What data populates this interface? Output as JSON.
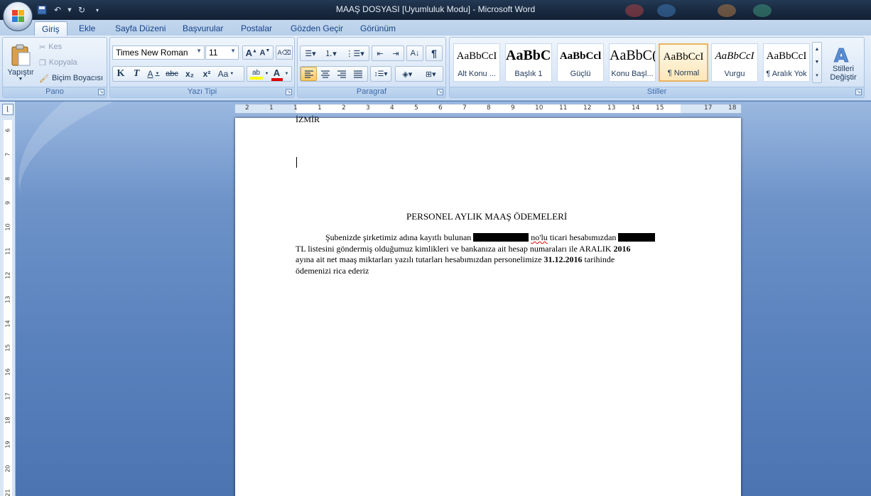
{
  "window": {
    "title": "MAAŞ DOSYASI [Uyumluluk Modu] - Microsoft Word"
  },
  "tabs": [
    "Giriş",
    "Ekle",
    "Sayfa Düzeni",
    "Başvurular",
    "Postalar",
    "Gözden Geçir",
    "Görünüm"
  ],
  "active_tab": "Giriş",
  "clipboard": {
    "paste": "Yapıştır",
    "cut": "Kes",
    "copy": "Kopyala",
    "format_painter": "Biçim Boyacısı",
    "label": "Pano"
  },
  "font": {
    "name": "Times New Roman",
    "size": "11",
    "label": "Yazı Tipi",
    "bold": "K",
    "italic": "T",
    "underline": "A",
    "strike": "abc",
    "sub": "x₂",
    "sup": "x²",
    "case": "Aa",
    "color": "A"
  },
  "paragraph": {
    "label": "Paragraf",
    "pilcrow": "¶"
  },
  "styles": {
    "label": "Stiller",
    "items": [
      {
        "sample": "AaBbCcI",
        "name": "Alt Konu ..."
      },
      {
        "sample": "AaBbC(",
        "name": "Başlık 1"
      },
      {
        "sample": "AaBbCcl",
        "name": "Güçlü"
      },
      {
        "sample": "AaBbC(",
        "name": "Konu Başl..."
      },
      {
        "sample": "AaBbCcI",
        "name": "¶ Normal"
      },
      {
        "sample": "AaBbCcI",
        "name": "Vurgu"
      },
      {
        "sample": "AaBbCcI",
        "name": "¶ Aralık Yok"
      }
    ],
    "change_styles": "Stilleri Değiştir"
  },
  "ruler": {
    "h_ticks": [
      "2",
      "1",
      "1",
      "1",
      "2",
      "3",
      "4",
      "5",
      "6",
      "7",
      "8",
      "9",
      "10",
      "11",
      "12",
      "13",
      "14",
      "15",
      "17",
      "18"
    ],
    "v_ticks": [
      "6",
      "7",
      "8",
      "9",
      "10",
      "11",
      "12",
      "13",
      "14",
      "15",
      "16",
      "17",
      "18",
      "19",
      "20",
      "21"
    ]
  },
  "document": {
    "top_line": "İZMİR",
    "heading": "PERSONEL AYLIK MAAŞ ÖDEMELERİ",
    "line1_a": "Şubenizde şirketimiz adına kayıtlı bulunan",
    "line1_b": "no'lu",
    "line1_c": "ticari hesabımızdan",
    "line2_a": "TL listesini  göndermiş olduğumuz kimlikleri  ve bankanıza ait hesap numaraları ile ARALIK",
    "line2_b": "2016",
    "line3_a": "ayına ait net maaş miktarları yazılı tutarları hesabımızdan personelimize",
    "line3_b": "31.12.2016",
    "line3_c": "tarihinde",
    "line4": "ödemenizi rica ederiz"
  },
  "colors": {
    "ribbon_bg": "#d7e5f6",
    "workspace_bg": "#5a82bd",
    "selected_style": "#fde7b8"
  }
}
